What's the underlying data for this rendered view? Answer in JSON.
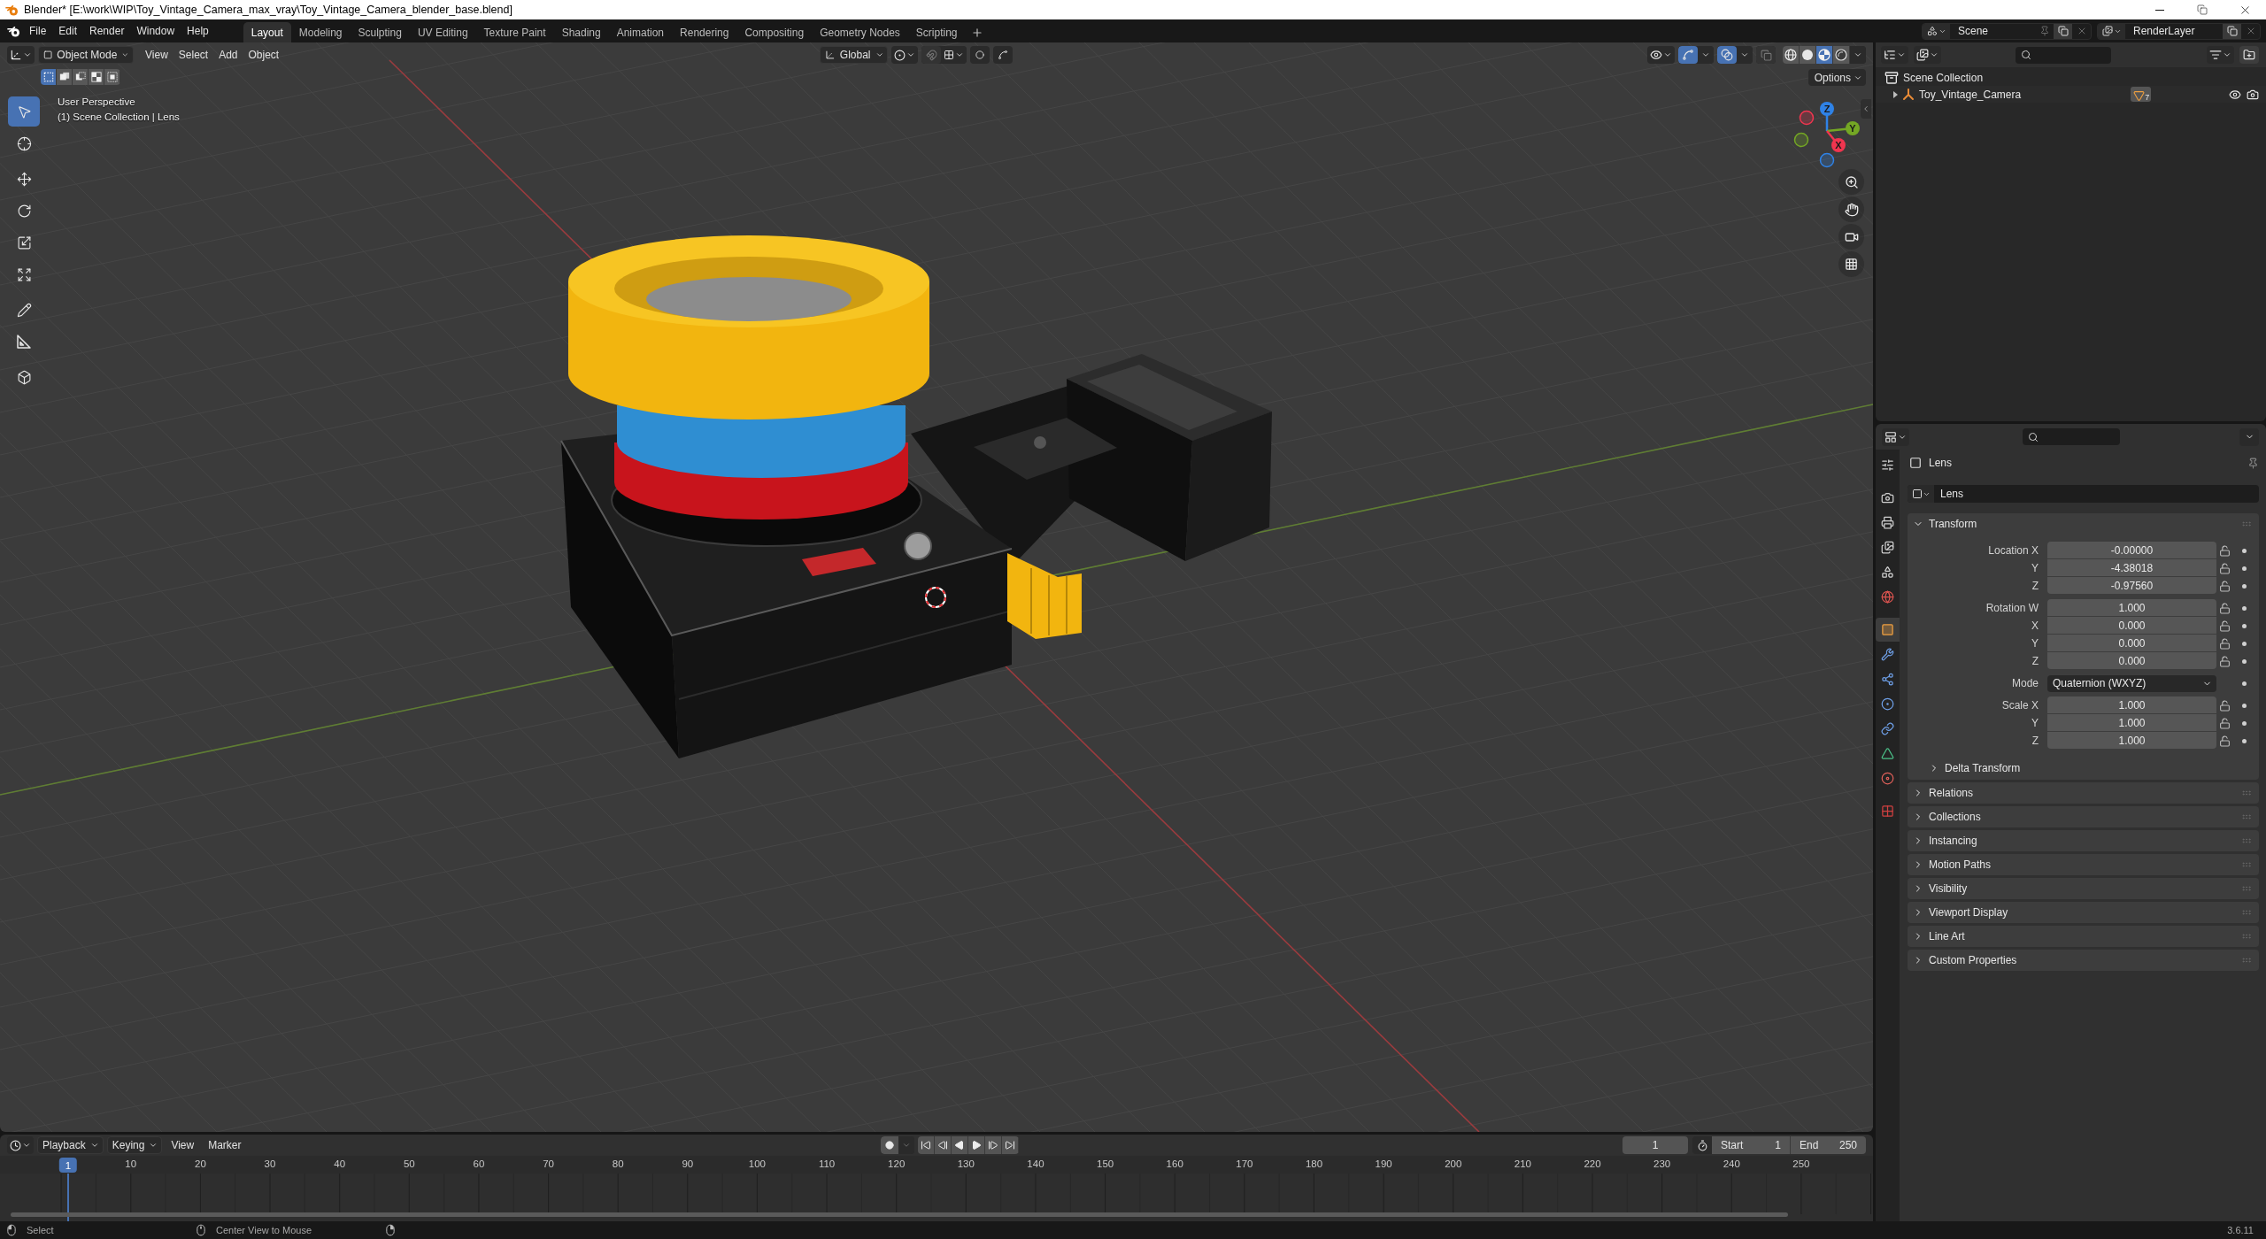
{
  "window": {
    "title": "Blender* [E:\\work\\WIP\\Toy_Vintage_Camera_max_vray\\Toy_Vintage_Camera_blender_base.blend]"
  },
  "menu": [
    "File",
    "Edit",
    "Render",
    "Window",
    "Help"
  ],
  "workspaces": [
    {
      "label": "Layout",
      "selected": true
    },
    {
      "label": "Modeling",
      "selected": false
    },
    {
      "label": "Sculpting",
      "selected": false
    },
    {
      "label": "UV Editing",
      "selected": false
    },
    {
      "label": "Texture Paint",
      "selected": false
    },
    {
      "label": "Shading",
      "selected": false
    },
    {
      "label": "Animation",
      "selected": false
    },
    {
      "label": "Rendering",
      "selected": false
    },
    {
      "label": "Compositing",
      "selected": false
    },
    {
      "label": "Geometry Nodes",
      "selected": false
    },
    {
      "label": "Scripting",
      "selected": false
    }
  ],
  "scene": {
    "name": "Scene"
  },
  "view_layer": {
    "name": "RenderLayer"
  },
  "viewport": {
    "mode": "Object Mode",
    "menus": [
      "View",
      "Select",
      "Add",
      "Object"
    ],
    "orientation": "Global",
    "toggles": [
      {
        "kind": "gizmos",
        "on": true
      },
      {
        "kind": "overlays",
        "on": true
      },
      {
        "kind": "xray",
        "on": false
      }
    ],
    "shading": [
      {
        "kind": "wireframe",
        "selected": false
      },
      {
        "kind": "solid",
        "selected": false
      },
      {
        "kind": "material",
        "selected": true
      },
      {
        "kind": "rendered",
        "selected": false
      }
    ],
    "select_modes": [
      {
        "kind": "set",
        "selected": true
      },
      {
        "kind": "extend",
        "selected": false
      },
      {
        "kind": "subtract",
        "selected": false
      },
      {
        "kind": "invert",
        "selected": false
      },
      {
        "kind": "intersect",
        "selected": false
      }
    ],
    "options": "Options",
    "overlay_text": [
      "User Perspective",
      "(1) Scene Collection | Lens"
    ],
    "tools": [
      {
        "kind": "select_box",
        "selected": true
      },
      {
        "kind": "cursor",
        "selected": false
      },
      {
        "kind": "move",
        "selected": false
      },
      {
        "kind": "rotate",
        "selected": false
      },
      {
        "kind": "scale",
        "selected": false
      },
      {
        "kind": "transform",
        "selected": false
      },
      {
        "kind": "annotate",
        "selected": false
      },
      {
        "kind": "measure",
        "selected": false
      },
      {
        "kind": "add_cube",
        "selected": false
      }
    ],
    "gizmo": [
      {
        "label": "Z",
        "color": "#2f82e6"
      },
      {
        "label": "Y",
        "color": "#74a724"
      },
      {
        "label": "X",
        "color": "#f0354f"
      }
    ],
    "navigation": [
      {
        "kind": "zoom"
      },
      {
        "kind": "pan"
      },
      {
        "kind": "camera"
      },
      {
        "kind": "ortho"
      }
    ]
  },
  "outliner": {
    "tree": [
      {
        "label": "Scene Collection",
        "kind": "collection",
        "children": [
          {
            "label": "Toy_Vintage_Camera",
            "kind": "empty",
            "expanded": false,
            "child_count": "7",
            "visible": true,
            "renderable": true
          }
        ]
      }
    ]
  },
  "properties": {
    "tabs": [
      {
        "kind": "tool",
        "selected": false
      },
      {
        "kind": "render",
        "selected": false
      },
      {
        "kind": "output",
        "selected": false
      },
      {
        "kind": "view_layer",
        "selected": false
      },
      {
        "kind": "scene",
        "selected": false
      },
      {
        "kind": "world",
        "selected": false
      },
      {
        "kind": "object",
        "selected": true
      },
      {
        "kind": "modifiers",
        "selected": false
      },
      {
        "kind": "particles",
        "selected": false
      },
      {
        "kind": "physics",
        "selected": false
      },
      {
        "kind": "constraints",
        "selected": false
      },
      {
        "kind": "data",
        "selected": false
      },
      {
        "kind": "material",
        "selected": false
      },
      {
        "kind": "texture",
        "selected": false
      }
    ],
    "title": "Lens",
    "datablock": "Lens",
    "panels": [
      {
        "label": "Transform",
        "expanded": true,
        "groups": [
          {
            "rows": [
              {
                "kind": "number",
                "label": "Location X",
                "value": "-0.00000"
              },
              {
                "kind": "number",
                "label": "Y",
                "value": "-4.38018"
              },
              {
                "kind": "number",
                "label": "Z",
                "value": "-0.97560"
              }
            ]
          },
          {
            "rows": [
              {
                "kind": "number",
                "label": "Rotation W",
                "value": "1.000"
              },
              {
                "kind": "number",
                "label": "X",
                "value": "0.000"
              },
              {
                "kind": "number",
                "label": "Y",
                "value": "0.000"
              },
              {
                "kind": "number",
                "label": "Z",
                "value": "0.000"
              }
            ]
          },
          {
            "rows": [
              {
                "kind": "dropdown",
                "label": "Mode",
                "value": "Quaternion (WXYZ)"
              }
            ]
          },
          {
            "rows": [
              {
                "kind": "number",
                "label": "Scale X",
                "value": "1.000"
              },
              {
                "kind": "number",
                "label": "Y",
                "value": "1.000"
              },
              {
                "kind": "number",
                "label": "Z",
                "value": "1.000"
              }
            ]
          }
        ],
        "subpanels": [
          {
            "label": "Delta Transform",
            "expanded": false
          }
        ]
      },
      {
        "label": "Relations",
        "expanded": false
      },
      {
        "label": "Collections",
        "expanded": false
      },
      {
        "label": "Instancing",
        "expanded": false
      },
      {
        "label": "Motion Paths",
        "expanded": false
      },
      {
        "label": "Visibility",
        "expanded": false
      },
      {
        "label": "Viewport Display",
        "expanded": false
      },
      {
        "label": "Line Art",
        "expanded": false
      },
      {
        "label": "Custom Properties",
        "expanded": false
      }
    ]
  },
  "timeline": {
    "menus": [
      "Playback",
      "Keying",
      "View",
      "Marker"
    ],
    "playhead": "1",
    "ruler": [
      "10",
      "20",
      "30",
      "40",
      "50",
      "60",
      "70",
      "80",
      "90",
      "100",
      "110",
      "120",
      "130",
      "140",
      "150",
      "160",
      "170",
      "180",
      "190",
      "200",
      "210",
      "220",
      "230",
      "240",
      "250"
    ],
    "current_frame": "1",
    "start_label": "Start",
    "start": "1",
    "end_label": "End",
    "end": "250"
  },
  "status_bar": {
    "items": [
      {
        "kind": "left_click",
        "label": "Select"
      },
      {
        "kind": "middle_click",
        "label": "Center View to Mouse"
      },
      {
        "kind": "right_click"
      }
    ],
    "version": "3.6.11"
  }
}
